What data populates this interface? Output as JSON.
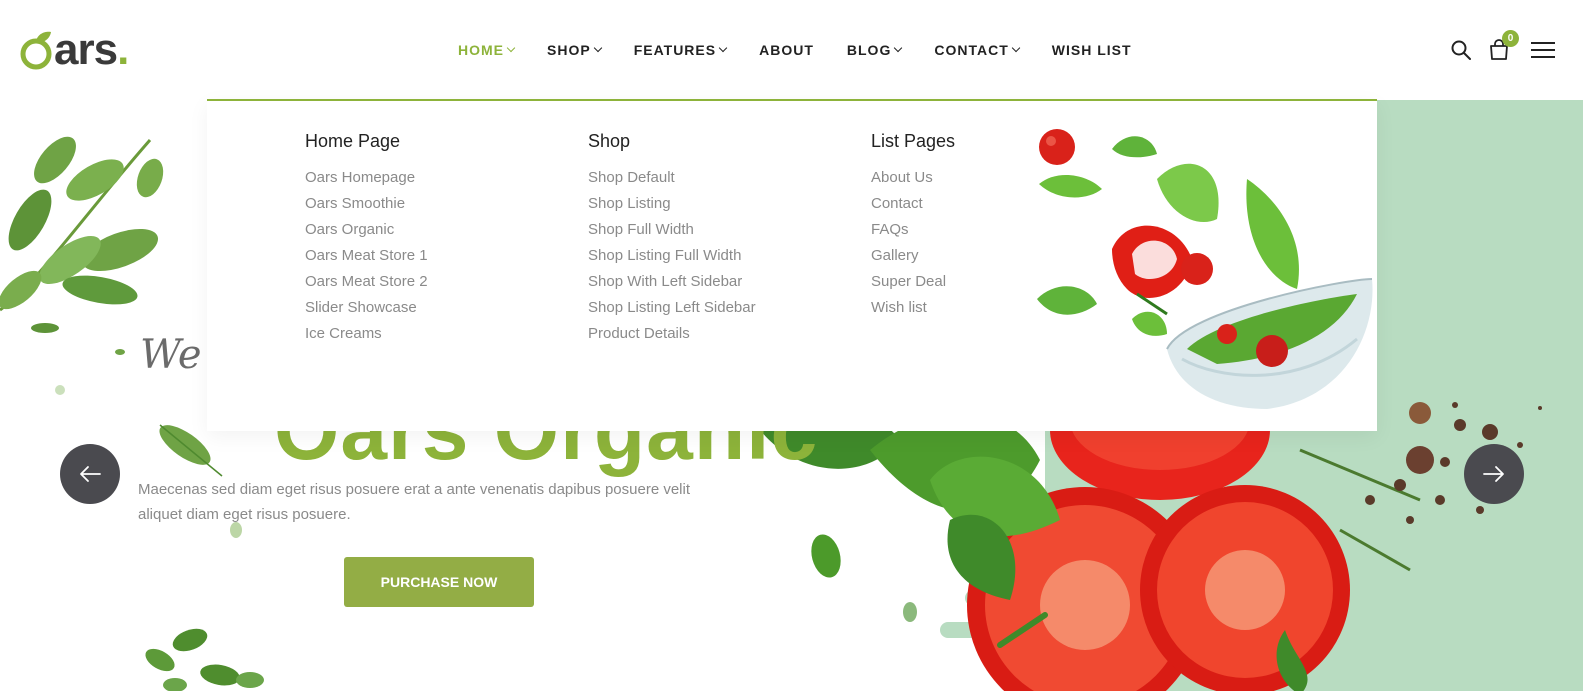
{
  "logo": {
    "text": "ars",
    "dot": "."
  },
  "nav": {
    "items": [
      {
        "label": "HOME",
        "dropdown": true,
        "active": true
      },
      {
        "label": "SHOP",
        "dropdown": true
      },
      {
        "label": "FEATURES",
        "dropdown": true
      },
      {
        "label": "ABOUT",
        "dropdown": false
      },
      {
        "label": "BLOG",
        "dropdown": true
      },
      {
        "label": "CONTACT",
        "dropdown": true
      },
      {
        "label": "WISH LIST",
        "dropdown": false
      }
    ]
  },
  "header_icons": {
    "search": "search-icon",
    "cart": "cart-icon",
    "cart_count": "0",
    "menu": "hamburger-menu-icon"
  },
  "mega_menu": {
    "columns": [
      {
        "title": "Home Page",
        "links": [
          "Oars Homepage",
          "Oars Smoothie",
          "Oars Organic",
          "Oars Meat Store 1",
          "Oars Meat Store 2",
          "Slider Showcase",
          "Ice Creams"
        ]
      },
      {
        "title": "Shop",
        "links": [
          "Shop Default",
          "Shop Listing",
          "Shop Full Width",
          "Shop Listing Full Width",
          "Shop With Left Sidebar",
          "Shop Listing Left Sidebar",
          "Product Details"
        ]
      },
      {
        "title": "List Pages",
        "links": [
          "About Us",
          "Contact",
          "FAQs",
          "Gallery",
          "Super Deal",
          "Wish list"
        ]
      }
    ],
    "image": "salad-bowl-illustration"
  },
  "hero": {
    "script": "We",
    "title": "Oars Organic",
    "description": "Maecenas sed diam eget risus posuere erat a ante venenatis dapibus posuere velit aliquet diam eget risus posuere.",
    "button": "PURCHASE NOW",
    "prev_icon": "arrow-left-icon",
    "next_icon": "arrow-right-icon"
  },
  "colors": {
    "accent": "#8db33a",
    "button": "#93ad45",
    "mint": "#b8dcc1",
    "arrow_bg": "#4a4a4f"
  }
}
